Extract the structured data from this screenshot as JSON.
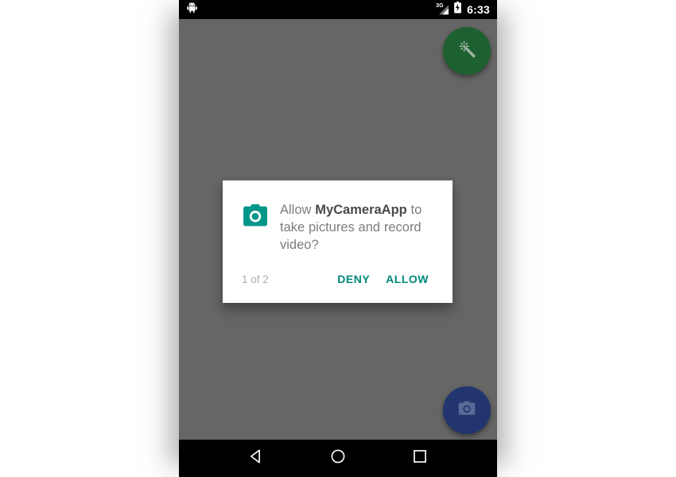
{
  "status_bar": {
    "notification_icon": "android-robot-icon",
    "network_label": "3G",
    "signal_icon": "signal-bars-icon",
    "battery_icon": "battery-charging-icon",
    "time": "6:33"
  },
  "camera": {
    "viewfinder_color": "#666666",
    "enhance_fab": {
      "icon": "magic-wand-icon",
      "color": "#1d6130"
    },
    "shutter_fab": {
      "icon": "camera-icon",
      "color": "#22356e"
    }
  },
  "dialog": {
    "icon": "camera-permission-icon",
    "icon_color": "#009688",
    "message_prefix": "Allow ",
    "app_name": "MyCameraApp",
    "message_suffix": " to take pictures and record video?",
    "counter": "1 of 2",
    "deny_label": "DENY",
    "allow_label": "ALLOW",
    "accent_color": "#00897b"
  },
  "nav_bar": {
    "back_icon": "back-triangle-icon",
    "home_icon": "home-circle-icon",
    "recents_icon": "recents-square-icon"
  }
}
